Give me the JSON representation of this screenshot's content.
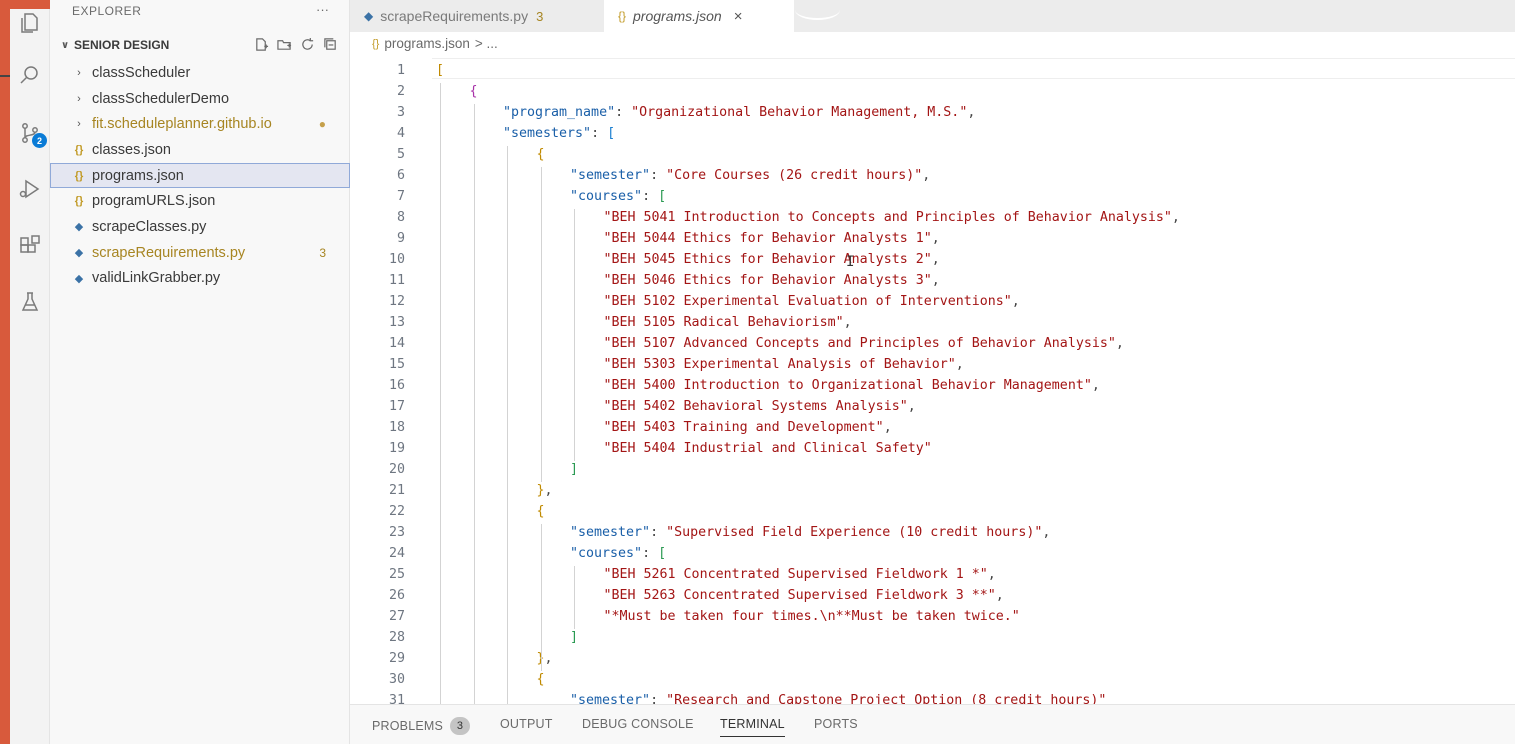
{
  "colors": {
    "accent_strip": "#d85a3c",
    "selection": "#e4e6f1",
    "badge_blue": "#0a7bd6",
    "modified": "#a78522"
  },
  "activity_bar": {
    "source_control_badge": "2",
    "icons": [
      "explorer-icon",
      "search-icon",
      "source-control-icon",
      "run-debug-icon",
      "extensions-icon",
      "testing-icon"
    ]
  },
  "sidebar": {
    "header": "EXPLORER",
    "header_more": "···",
    "section": "SENIOR DESIGN",
    "items": [
      {
        "label": "classScheduler",
        "kind": "folder"
      },
      {
        "label": "classSchedulerDemo",
        "kind": "folder"
      },
      {
        "label": "fit.scheduleplanner.github.io",
        "kind": "folder",
        "modified": true,
        "trail": "●"
      },
      {
        "label": "classes.json",
        "kind": "json"
      },
      {
        "label": "programs.json",
        "kind": "json",
        "selected": true
      },
      {
        "label": "programURLS.json",
        "kind": "json"
      },
      {
        "label": "scrapeClasses.py",
        "kind": "py"
      },
      {
        "label": "scrapeRequirements.py",
        "kind": "py",
        "modified": true,
        "trail": "3"
      },
      {
        "label": "validLinkGrabber.py",
        "kind": "py"
      }
    ]
  },
  "tabs": [
    {
      "label": "scrapeRequirements.py",
      "count": "3"
    },
    {
      "label": "programs.json",
      "close": "×"
    }
  ],
  "breadcrumb": {
    "file": "programs.json",
    "rest": "> ..."
  },
  "editor": {
    "lines": [
      {
        "n": "1",
        "indent": 0,
        "segs": [
          [
            "b1",
            "["
          ]
        ]
      },
      {
        "n": "2",
        "indent": 1,
        "segs": [
          [
            "b2",
            "{"
          ]
        ]
      },
      {
        "n": "3",
        "indent": 2,
        "segs": [
          [
            "k",
            "\"program_name\""
          ],
          [
            "p",
            ": "
          ],
          [
            "s",
            "\"Organizational Behavior Management, M.S.\""
          ],
          [
            "p",
            ","
          ]
        ]
      },
      {
        "n": "4",
        "indent": 2,
        "segs": [
          [
            "k",
            "\"semesters\""
          ],
          [
            "p",
            ": "
          ],
          [
            "b3",
            "["
          ]
        ]
      },
      {
        "n": "5",
        "indent": 3,
        "segs": [
          [
            "b1",
            "{"
          ]
        ]
      },
      {
        "n": "6",
        "indent": 4,
        "segs": [
          [
            "k",
            "\"semester\""
          ],
          [
            "p",
            ": "
          ],
          [
            "s",
            "\"Core Courses (26 credit hours)\""
          ],
          [
            "p",
            ","
          ]
        ]
      },
      {
        "n": "7",
        "indent": 4,
        "segs": [
          [
            "k",
            "\"courses\""
          ],
          [
            "p",
            ": "
          ],
          [
            "b4",
            "["
          ]
        ]
      },
      {
        "n": "8",
        "indent": 5,
        "segs": [
          [
            "s",
            "\"BEH 5041 Introduction to Concepts and Principles of Behavior Analysis\""
          ],
          [
            "p",
            ","
          ]
        ]
      },
      {
        "n": "9",
        "indent": 5,
        "segs": [
          [
            "s",
            "\"BEH 5044 Ethics for Behavior Analysts 1\""
          ],
          [
            "p",
            ","
          ]
        ]
      },
      {
        "n": "10",
        "indent": 5,
        "segs": [
          [
            "s",
            "\"BEH 5045 Ethics for Behavior Analysts 2\""
          ],
          [
            "p",
            ","
          ]
        ]
      },
      {
        "n": "11",
        "indent": 5,
        "segs": [
          [
            "s",
            "\"BEH 5046 Ethics for Behavior Analysts 3\""
          ],
          [
            "p",
            ","
          ]
        ]
      },
      {
        "n": "12",
        "indent": 5,
        "segs": [
          [
            "s",
            "\"BEH 5102 Experimental Evaluation of Interventions\""
          ],
          [
            "p",
            ","
          ]
        ]
      },
      {
        "n": "13",
        "indent": 5,
        "segs": [
          [
            "s",
            "\"BEH 5105 Radical Behaviorism\""
          ],
          [
            "p",
            ","
          ]
        ]
      },
      {
        "n": "14",
        "indent": 5,
        "segs": [
          [
            "s",
            "\"BEH 5107 Advanced Concepts and Principles of Behavior Analysis\""
          ],
          [
            "p",
            ","
          ]
        ]
      },
      {
        "n": "15",
        "indent": 5,
        "segs": [
          [
            "s",
            "\"BEH 5303 Experimental Analysis of Behavior\""
          ],
          [
            "p",
            ","
          ]
        ]
      },
      {
        "n": "16",
        "indent": 5,
        "segs": [
          [
            "s",
            "\"BEH 5400 Introduction to Organizational Behavior Management\""
          ],
          [
            "p",
            ","
          ]
        ]
      },
      {
        "n": "17",
        "indent": 5,
        "segs": [
          [
            "s",
            "\"BEH 5402 Behavioral Systems Analysis\""
          ],
          [
            "p",
            ","
          ]
        ]
      },
      {
        "n": "18",
        "indent": 5,
        "segs": [
          [
            "s",
            "\"BEH 5403 Training and Development\""
          ],
          [
            "p",
            ","
          ]
        ]
      },
      {
        "n": "19",
        "indent": 5,
        "segs": [
          [
            "s",
            "\"BEH 5404 Industrial and Clinical Safety\""
          ]
        ]
      },
      {
        "n": "20",
        "indent": 4,
        "segs": [
          [
            "b4",
            "]"
          ]
        ]
      },
      {
        "n": "21",
        "indent": 3,
        "segs": [
          [
            "b1",
            "}"
          ],
          [
            "p",
            ","
          ]
        ]
      },
      {
        "n": "22",
        "indent": 3,
        "segs": [
          [
            "b1",
            "{"
          ]
        ]
      },
      {
        "n": "23",
        "indent": 4,
        "segs": [
          [
            "k",
            "\"semester\""
          ],
          [
            "p",
            ": "
          ],
          [
            "s",
            "\"Supervised Field Experience (10 credit hours)\""
          ],
          [
            "p",
            ","
          ]
        ]
      },
      {
        "n": "24",
        "indent": 4,
        "segs": [
          [
            "k",
            "\"courses\""
          ],
          [
            "p",
            ": "
          ],
          [
            "b4",
            "["
          ]
        ]
      },
      {
        "n": "25",
        "indent": 5,
        "segs": [
          [
            "s",
            "\"BEH 5261 Concentrated Supervised Fieldwork 1 *\""
          ],
          [
            "p",
            ","
          ]
        ]
      },
      {
        "n": "26",
        "indent": 5,
        "segs": [
          [
            "s",
            "\"BEH 5263 Concentrated Supervised Fieldwork 3 **\""
          ],
          [
            "p",
            ","
          ]
        ]
      },
      {
        "n": "27",
        "indent": 5,
        "segs": [
          [
            "s",
            "\"*Must be taken four times.\\n**Must be taken twice.\""
          ]
        ]
      },
      {
        "n": "28",
        "indent": 4,
        "segs": [
          [
            "b4",
            "]"
          ]
        ]
      },
      {
        "n": "29",
        "indent": 3,
        "segs": [
          [
            "b1",
            "}"
          ],
          [
            "p",
            ","
          ]
        ]
      },
      {
        "n": "30",
        "indent": 3,
        "segs": [
          [
            "b1",
            "{"
          ]
        ]
      },
      {
        "n": "31",
        "indent": 4,
        "segs": [
          [
            "k",
            "\"semester\""
          ],
          [
            "p",
            ": "
          ],
          [
            "s",
            "\"Research and Capstone Project Option (8 credit hours)\""
          ]
        ]
      }
    ]
  },
  "panel": {
    "tabs": [
      {
        "label": "PROBLEMS",
        "badge": "3"
      },
      {
        "label": "OUTPUT"
      },
      {
        "label": "DEBUG CONSOLE"
      },
      {
        "label": "TERMINAL",
        "active": true
      },
      {
        "label": "PORTS"
      }
    ]
  }
}
